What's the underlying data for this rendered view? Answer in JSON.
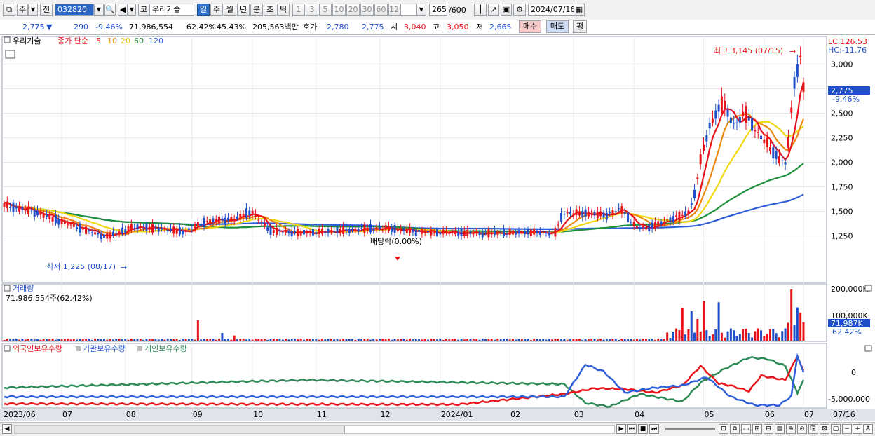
{
  "toolbar": {
    "market_type": "주",
    "compare_label": "전",
    "code": "032820",
    "name_prefix": "코",
    "stock_name": "우리기술",
    "periods": [
      "일",
      "주",
      "월",
      "년",
      "분",
      "초",
      "틱"
    ],
    "active_period": "일",
    "intervals": [
      "1",
      "3",
      "5",
      "10",
      "20",
      "30",
      "60",
      "120"
    ],
    "count": "265",
    "count_total": "/600",
    "date": "2024/07/16"
  },
  "info": {
    "price": "2,775",
    "arrow": "▼",
    "change": "290",
    "change_rate": "-9.46%",
    "volume": "71,986,554",
    "turnover": "62.42%",
    "ratio": "45.43%",
    "amount": "205,563백만",
    "quote_label": "호가",
    "ask": "2,780",
    "bid": "2,775",
    "open_label": "시",
    "open": "3,040",
    "high_label": "고",
    "high": "3,050",
    "low_label": "저",
    "low": "2,665",
    "buy_button": "매수",
    "sell_button": "매도",
    "eval_button": "평"
  },
  "price_panel": {
    "stock_label": "우리기술",
    "ma_title": "종가 단순",
    "ma_periods": [
      "5",
      "10",
      "20",
      "60",
      "120"
    ],
    "lc": "LC:126.53",
    "hc": "HC:-11.76",
    "y_ticks": [
      "3,000",
      "2,750",
      "2,500",
      "2,250",
      "2,000",
      "1,750",
      "1,500",
      "1,250"
    ],
    "current_price": "2,775",
    "current_change": "-9.46%",
    "high_annotation": "최고 3,145 (07/15)",
    "low_annotation": "최저 1,225 (08/17)",
    "dividend_annotation": "배당락(0.00%)",
    "colors": {
      "up": "#e8141a",
      "down": "#1f4fc8",
      "ma5": "#e8141a",
      "ma10": "#ef8a10",
      "ma20": "#f1d810",
      "ma60": "#1e8f3a",
      "ma120": "#2f5fd8"
    }
  },
  "volume_panel": {
    "title": "거래량",
    "value_text": "71,986,554주(62.42%)",
    "y_ticks": [
      "200,000K",
      "100,000K"
    ],
    "current_value": "71,987K",
    "current_pct": "62.42%"
  },
  "holding_panel": {
    "legends": [
      "외국인보유수량",
      "기관보유수량",
      "개인보유수량"
    ],
    "colors": [
      "#e8141a",
      "#2f5fd8",
      "#2e8b57"
    ],
    "y_ticks": [
      "0",
      "-5,000,000"
    ]
  },
  "x_axis": {
    "labels": [
      "2023/06",
      "07",
      "08",
      "09",
      "10",
      "11",
      "12",
      "2024/01",
      "02",
      "03",
      "04",
      "05",
      "06",
      "07"
    ],
    "end_label": "07/16"
  }
}
